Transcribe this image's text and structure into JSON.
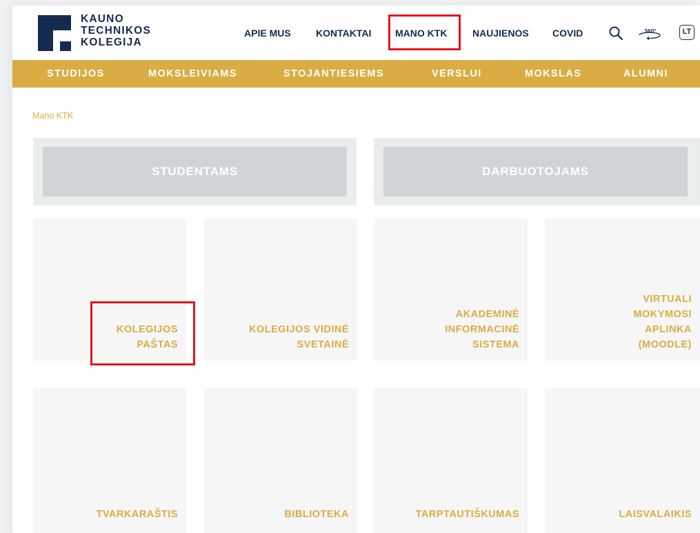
{
  "brand": {
    "logo_lines": [
      "KAUNO",
      "TECHNIKOS",
      "KOLEGIJA"
    ],
    "navy": "#142b4f",
    "gold": "#d9ad44"
  },
  "topnav": {
    "items": [
      "APIE MUS",
      "KONTAKTAI",
      "MANO KTK",
      "NAUJIENOS",
      "COVID"
    ],
    "highlighted": "MANO KTK",
    "search_icon": "search-icon",
    "tour_icon": "360-tour-icon",
    "tour_label": "360°",
    "language": "LT"
  },
  "menubar": {
    "items": [
      "STUDIJOS",
      "MOKSLEIVIAMS",
      "STOJANTIESIEMS",
      "VERSLUI",
      "MOKSLAS",
      "ALUMNI"
    ]
  },
  "breadcrumb": "Mano KTK",
  "sections": [
    "STUDENTAMS",
    "DARBUOTOJAMS"
  ],
  "tiles": [
    "KOLEGIJOS\nPAŠTAS",
    "KOLEGIJOS VIDINĖ\nSVETAINĖ",
    "AKADEMINĖ\nINFORMACINĖ\nSISTEMA",
    "VIRTUALI\nMOKYMOSI\nAPLINKA\n(MOODLE)",
    "TVARKARAŠTIS",
    "BIBLIOTEKA",
    "TARPTAUTIŠKUMAS",
    "LAISVALAIKIS"
  ],
  "highlight_color": "#e3151d"
}
